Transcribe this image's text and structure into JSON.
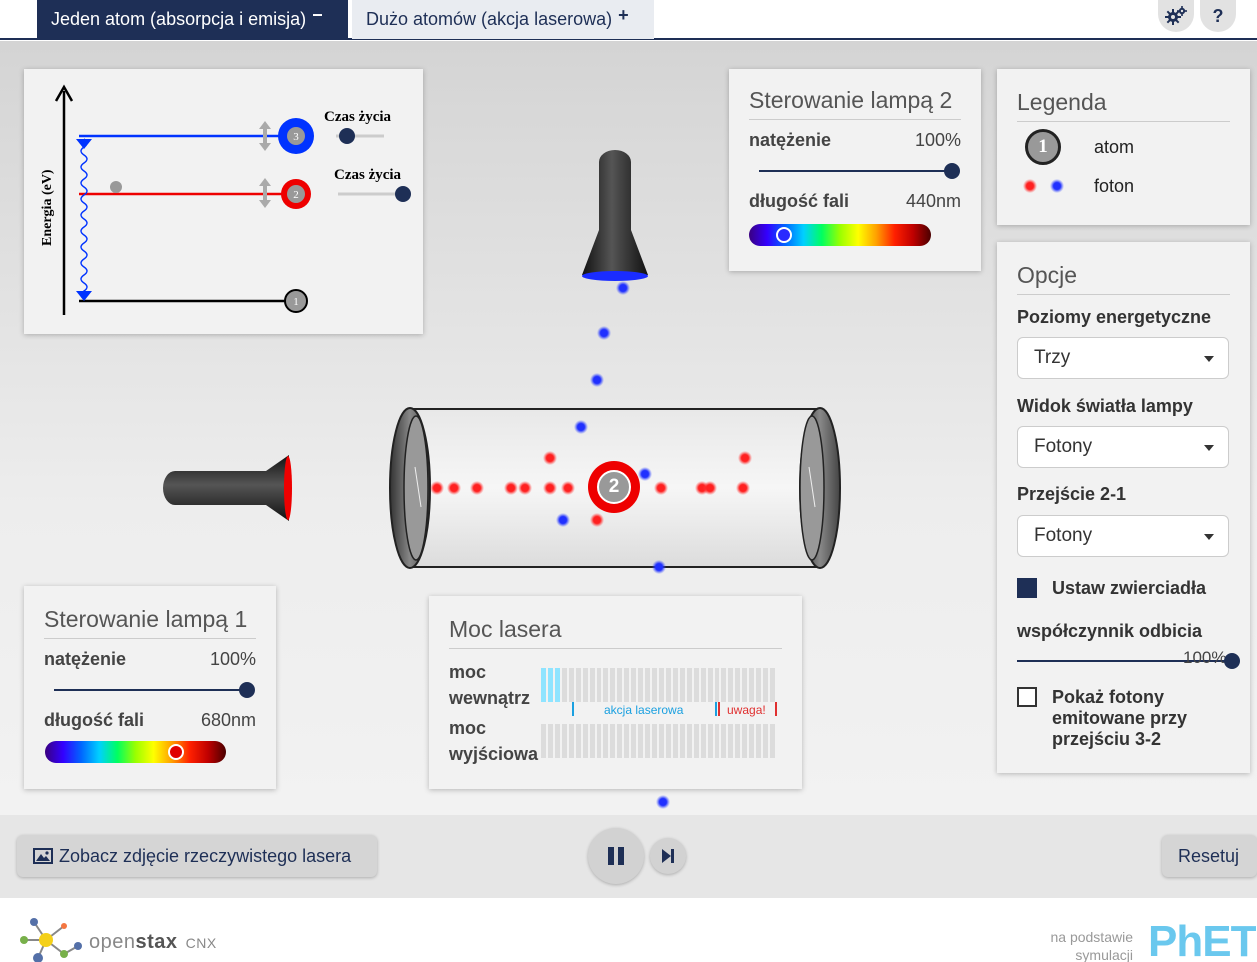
{
  "tabs": [
    {
      "label": "Jeden atom (absorpcja i emisja)",
      "sign": "−"
    },
    {
      "label": "Dużo atomów (akcja laserowa)",
      "sign": "+"
    }
  ],
  "header": {
    "settings_icon": "gears-icon",
    "help_label": "?"
  },
  "energy_diagram": {
    "axis_label": "Energia (eV)",
    "lifetime_label_1": "Czas życia",
    "lifetime_label_2": "Czas życia",
    "levels": [
      "3",
      "2",
      "1"
    ]
  },
  "lamp2": {
    "title": "Sterowanie lampą 2",
    "intensity_label": "natężenie",
    "intensity_value": "100%",
    "intensity": 1.0,
    "wavelength_label": "długość fali",
    "wavelength_value": "440nm",
    "knob_color": "#2a2aff"
  },
  "lamp1": {
    "title": "Sterowanie lampą 1",
    "intensity_label": "natężenie",
    "intensity_value": "100%",
    "intensity": 1.0,
    "wavelength_label": "długość fali",
    "wavelength_value": "680nm",
    "knob_color": "#e00000"
  },
  "legend": {
    "title": "Legenda",
    "atom_label": "atom",
    "atom_number": "1",
    "photon_label": "foton"
  },
  "options": {
    "title": "Opcje",
    "energy_levels_label": "Poziomy energetyczne",
    "energy_levels_value": "Trzy",
    "lamp_view_label": "Widok światła lampy",
    "lamp_view_value": "Fotony",
    "transition_label": "Przejście 2-1",
    "transition_value": "Fotony",
    "mirrors_label": "Ustaw zwierciadła",
    "mirrors_checked": true,
    "reflectivity_label": "współczynnik odbicia",
    "reflectivity_value": "100%",
    "reflectivity": 1.0,
    "show_photons_label_1": "Pokaż fotony",
    "show_photons_label_2": "emitowane przy",
    "show_photons_label_3": "przejściu 3-2",
    "show_photons_checked": false
  },
  "laser_power": {
    "title": "Moc lasera",
    "internal_label_1": "moc",
    "internal_label_2": "wewnątrz",
    "output_label_1": "moc",
    "output_label_2": "wyjściowa",
    "lasing_label": "akcja laserowa",
    "warning_label": "uwaga!",
    "internal_fill_segments": 3
  },
  "atom": {
    "level": "2"
  },
  "bottom": {
    "photo_button": "Zobacz zdjęcie rzeczywistego lasera",
    "reset_button": "Resetuj"
  },
  "footer": {
    "brand_open": "open",
    "brand_stax": "stax",
    "brand_cnx": "CNX",
    "based_on_1": "na podstawie",
    "based_on_2": "symulacji",
    "phet": "PhET"
  },
  "colors": {
    "navy": "#1e2f56",
    "photon_blue": "#2030ff",
    "photon_red": "#ff2020",
    "level3": "#0033ff",
    "level2": "#ee0000"
  }
}
